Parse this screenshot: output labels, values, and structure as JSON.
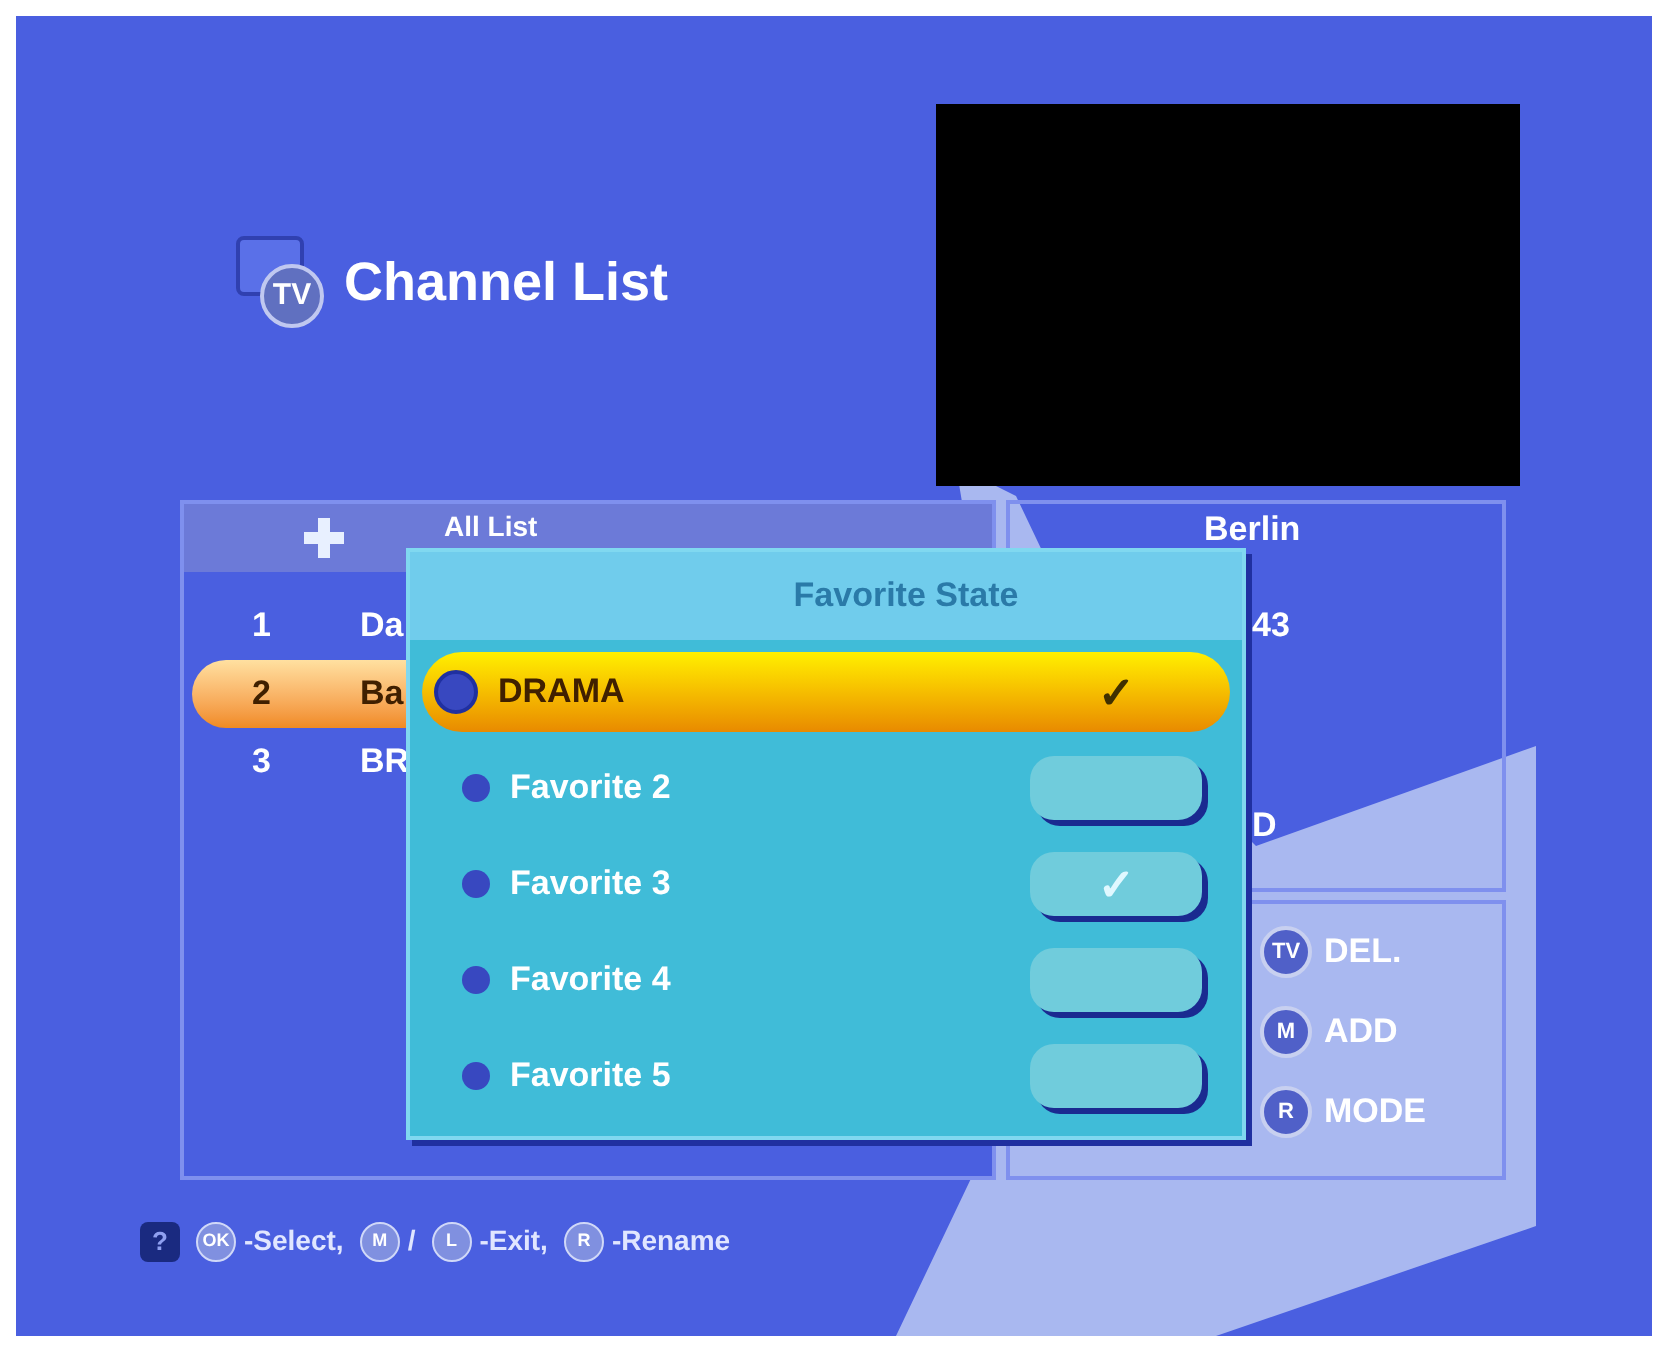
{
  "header": {
    "icon_label": "TV",
    "title": "Channel List"
  },
  "channel_list": {
    "header": "All List",
    "rows": [
      {
        "number": "1",
        "name": "Da",
        "selected": false
      },
      {
        "number": "2",
        "name": "Ba",
        "selected": true
      },
      {
        "number": "3",
        "name": "BR",
        "selected": false
      }
    ]
  },
  "info": {
    "lines": [
      "Berlin",
      "43",
      "D"
    ]
  },
  "keys": [
    {
      "key": "TV",
      "label": "DEL."
    },
    {
      "key": "M",
      "label": "ADD"
    },
    {
      "key": "R",
      "label": "MODE"
    }
  ],
  "dialog": {
    "title": "Favorite State",
    "items": [
      {
        "label": "DRAMA",
        "selected": true,
        "checked": true
      },
      {
        "label": "Favorite 2",
        "selected": false,
        "checked": false
      },
      {
        "label": "Favorite 3",
        "selected": false,
        "checked": true
      },
      {
        "label": "Favorite 4",
        "selected": false,
        "checked": false
      },
      {
        "label": "Favorite 5",
        "selected": false,
        "checked": false
      }
    ]
  },
  "check_mark": "✓",
  "help": {
    "icon": "?",
    "parts": [
      {
        "key": "OK",
        "text": "-Select,"
      },
      {
        "key": "M",
        "text": "/"
      },
      {
        "key": "L",
        "text": "-Exit,"
      },
      {
        "key": "R",
        "text": "-Rename"
      }
    ]
  }
}
